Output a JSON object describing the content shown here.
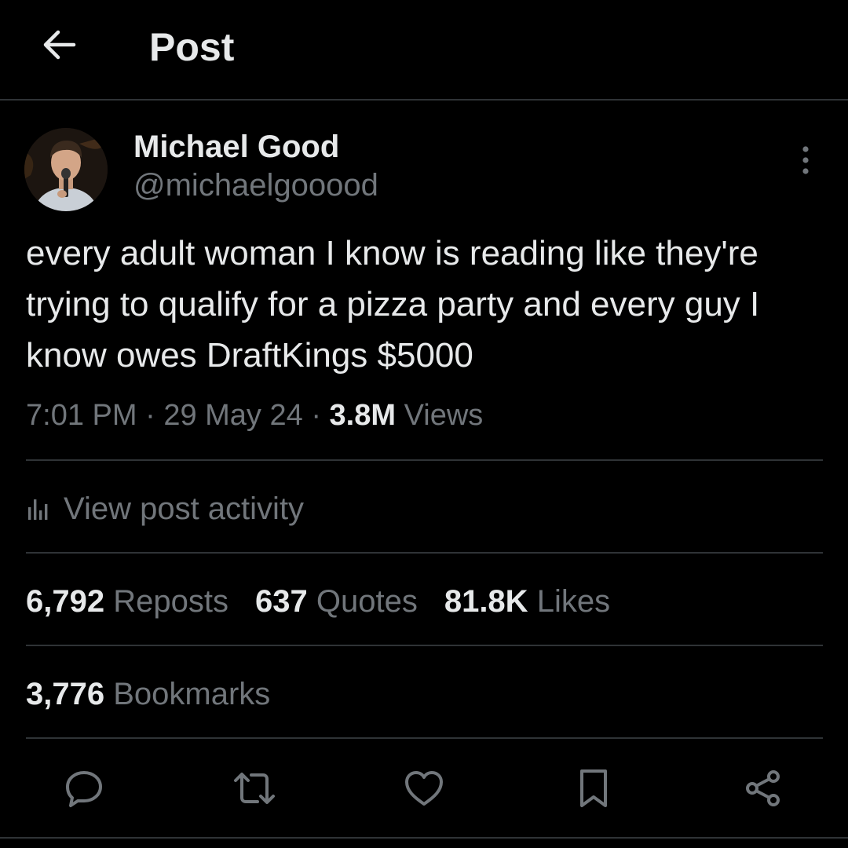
{
  "header": {
    "title": "Post",
    "back_icon": "arrow-left-icon"
  },
  "author": {
    "name": "Michael Good",
    "handle": "@michaelgooood"
  },
  "post": {
    "text": "every adult woman I know is reading like they're trying to qualify for a pizza party and every guy I know owes DraftKings $5000",
    "time": "7:01 PM",
    "date": "29 May 24",
    "views_count": "3.8M",
    "views_label": "Views"
  },
  "activity": {
    "label": "View post activity",
    "icon": "bar-chart-icon"
  },
  "stats": {
    "reposts": {
      "count": "6,792",
      "label": "Reposts"
    },
    "quotes": {
      "count": "637",
      "label": "Quotes"
    },
    "likes": {
      "count": "81.8K",
      "label": "Likes"
    },
    "bookmarks": {
      "count": "3,776",
      "label": "Bookmarks"
    }
  },
  "actions": [
    "reply-icon",
    "repost-icon",
    "like-icon",
    "bookmark-icon",
    "share-icon"
  ],
  "colors": {
    "background": "#000000",
    "primary_text": "#e7e9ea",
    "secondary_text": "#71767b",
    "divider": "#2f3336"
  }
}
